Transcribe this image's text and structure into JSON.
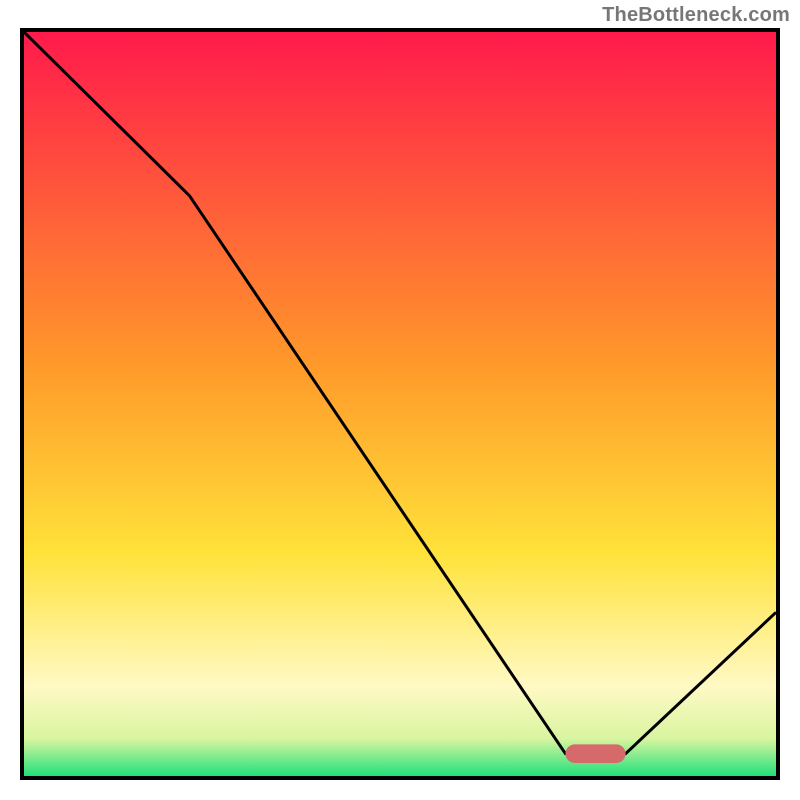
{
  "watermark": "TheBottleneck.com",
  "chart_data": {
    "type": "line",
    "title": "",
    "xlabel": "",
    "ylabel": "",
    "xlim": [
      0,
      100
    ],
    "ylim": [
      0,
      100
    ],
    "grid": false,
    "series": [
      {
        "name": "bottleneck-curve",
        "x": [
          0,
          22,
          72,
          80,
          100
        ],
        "values": [
          100,
          78,
          3,
          3,
          22
        ]
      }
    ],
    "marker": {
      "name": "highlight-bar",
      "x_start": 72,
      "x_end": 80,
      "y": 3,
      "color": "#d66a6a",
      "thickness": 2.5
    },
    "background_gradient": {
      "stops": [
        {
          "offset": 0.0,
          "color": "#ff1a4b"
        },
        {
          "offset": 0.45,
          "color": "#ff9a2a"
        },
        {
          "offset": 0.7,
          "color": "#ffe23a"
        },
        {
          "offset": 0.88,
          "color": "#fff9c4"
        },
        {
          "offset": 0.95,
          "color": "#d8f5a0"
        },
        {
          "offset": 1.0,
          "color": "#22e07a"
        }
      ]
    }
  }
}
